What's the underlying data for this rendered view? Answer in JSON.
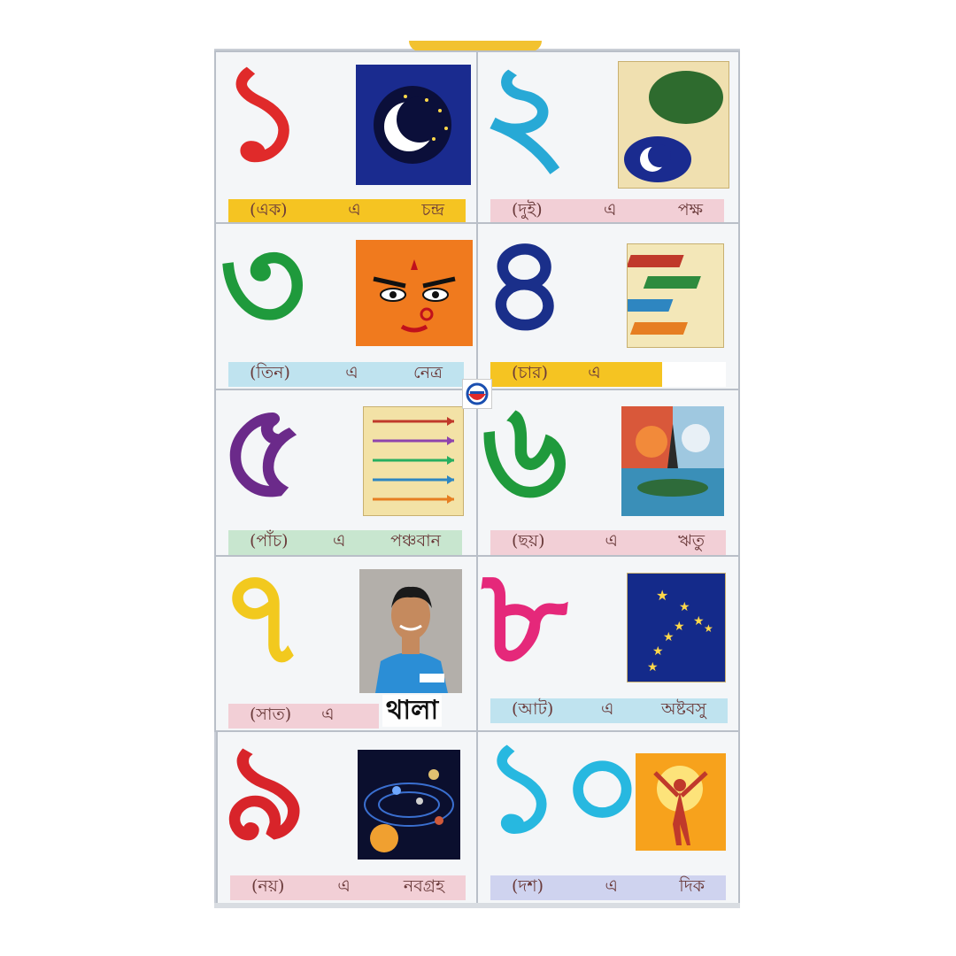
{
  "cells": [
    {
      "numeral": "১",
      "color": "#e02a2a",
      "caption": [
        "(এক)",
        "এ",
        "চন্দ্র"
      ],
      "caption_bg": "#f5c422",
      "picture": "moon-icon"
    },
    {
      "numeral": "২",
      "color": "#27a9d6",
      "caption": [
        "(দুই)",
        "এ",
        "পক্ষ"
      ],
      "caption_bg": "#f2cfd6",
      "picture": "moon-phases-icon"
    },
    {
      "numeral": "৩",
      "color": "#1f9a3c",
      "caption": [
        "(তিন)",
        "এ",
        "নেত্র"
      ],
      "caption_bg": "#bfe3ef",
      "picture": "goddess-face-icon"
    },
    {
      "numeral": "৪",
      "color": "#1a2f8a",
      "caption": [
        "(চার)",
        "এ",
        ""
      ],
      "caption_bg": "#f5c422",
      "picture": "books-icon"
    },
    {
      "numeral": "৫",
      "color": "#6b2a8a",
      "caption": [
        "(পাঁচ)",
        "এ",
        "পঞ্চবান"
      ],
      "caption_bg": "#c8e6cf",
      "picture": "arrows-icon"
    },
    {
      "numeral": "৬",
      "color": "#1f9a3c",
      "caption": [
        "(ছয়)",
        "এ",
        "ঋতু"
      ],
      "caption_bg": "#f2cfd6",
      "picture": "seasons-icon"
    },
    {
      "numeral": "৭",
      "color": "#f2c91e",
      "caption": [
        "(সাত)",
        "এ",
        ""
      ],
      "caption_bg": "#f2cfd6",
      "picture": "cricketer-photo"
    },
    {
      "numeral": "৮",
      "color": "#e5287a",
      "caption": [
        "(আট)",
        "এ",
        "অষ্টবসু"
      ],
      "caption_bg": "#bfe3ef",
      "picture": "stars-icon"
    },
    {
      "numeral": "৯",
      "color": "#d8242a",
      "caption": [
        "(নয়)",
        "এ",
        "নবগ্রহ"
      ],
      "caption_bg": "#f2cfd6",
      "picture": "planets-icon"
    },
    {
      "numeral": "১০",
      "color": "#27b8e0",
      "caption": [
        "(দশ)",
        "এ",
        "দিক"
      ],
      "caption_bg": "#cfd3ef",
      "picture": "sun-figure-icon"
    }
  ],
  "overlay": {
    "word": "থালা"
  }
}
